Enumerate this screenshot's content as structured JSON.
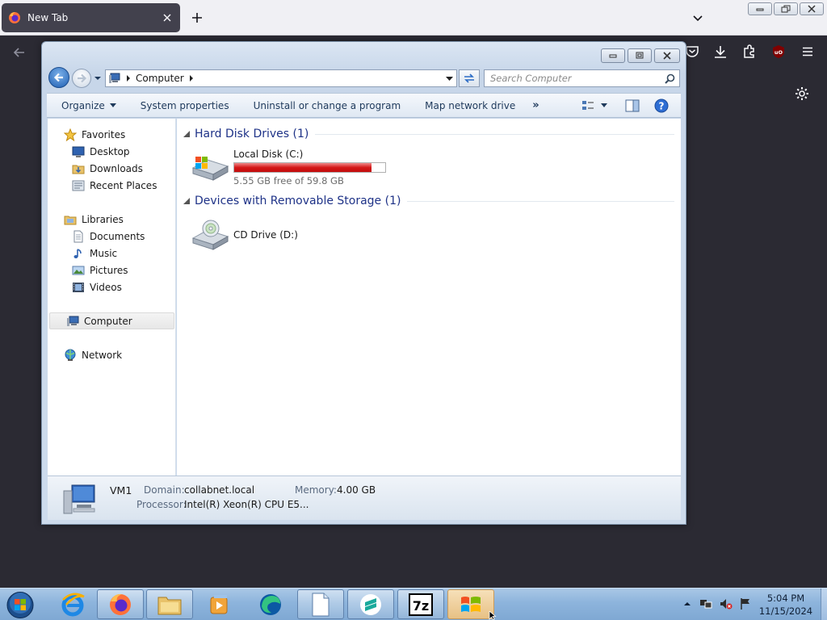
{
  "browser": {
    "tab_title": "New Tab",
    "tab_icon": "firefox-icon",
    "toolbar_icons": [
      "pocket-icon",
      "download-icon",
      "extensions-icon",
      "ublock-icon",
      "menu-icon"
    ]
  },
  "explorer": {
    "address": {
      "location": "Computer"
    },
    "search": {
      "placeholder": "Search Computer"
    },
    "commands": {
      "organize": "Organize",
      "system_properties": "System properties",
      "uninstall": "Uninstall or change a program",
      "map_drive": "Map network drive",
      "more": "»"
    },
    "nav": {
      "favorites": "Favorites",
      "favorites_items": [
        "Desktop",
        "Downloads",
        "Recent Places"
      ],
      "libraries": "Libraries",
      "libraries_items": [
        "Documents",
        "Music",
        "Pictures",
        "Videos"
      ],
      "computer": "Computer",
      "network": "Network"
    },
    "groups": [
      {
        "title": "Hard Disk Drives (1)",
        "drives": [
          {
            "name": "Local Disk (C:)",
            "free_text": "5.55 GB free of 59.8 GB",
            "used_fraction": 0.907
          }
        ]
      },
      {
        "title": "Devices with Removable Storage (1)",
        "drives": [
          {
            "name": "CD Drive (D:)"
          }
        ]
      }
    ],
    "details": {
      "computer_name": "VM1",
      "domain_label": "Domain:",
      "domain_value": "collabnet.local",
      "memory_label": "Memory:",
      "memory_value": "4.00 GB",
      "processor_label": "Processor:",
      "processor_value": "Intel(R) Xeon(R) CPU E5..."
    }
  },
  "taskbar": {
    "pinned": [
      "internet-explorer",
      "firefox",
      "windows-explorer",
      "media-player",
      "edge",
      "notepad",
      "sublime-text",
      "7-zip",
      "windows-explorer-window"
    ],
    "clock": {
      "time": "5:04 PM",
      "date": "11/15/2024"
    }
  },
  "colors": {
    "firefox_dark": "#2b2a33",
    "explorer_group_header": "#1e3287",
    "disk_bar_red": "#d41818",
    "taskbar_blue": "#8db4dc"
  }
}
